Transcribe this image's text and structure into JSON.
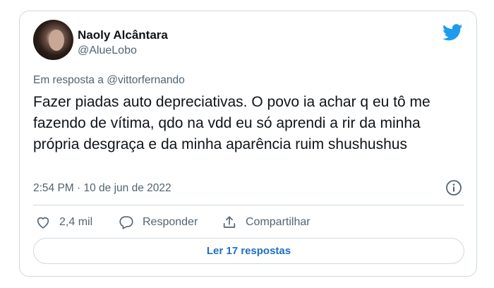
{
  "author": {
    "name": "Naoly Alcântara",
    "handle": "@AlueLobo"
  },
  "reply_to": {
    "prefix": "Em resposta a ",
    "handle": "@vittorfernando"
  },
  "tweet": {
    "text": "Fazer piadas auto depreciativas. O povo ia achar q eu tô me fazendo de vítima, qdo na vdd eu só aprendi a rir da minha própria desgraça e da minha aparência ruim shushushus",
    "timestamp": "2:54 PM · 10 de jun de 2022"
  },
  "actions": {
    "like_count": "2,4 mil",
    "reply_label": "Responder",
    "share_label": "Compartilhar"
  },
  "replies_button": "Ler 17 respostas",
  "icons": {
    "logo": "twitter-bird-icon",
    "info": "info-icon",
    "like": "heart-icon",
    "reply": "comment-icon",
    "share": "share-icon"
  },
  "colors": {
    "brand": "#1d9bf0",
    "text": "#0f1419",
    "muted": "#536471",
    "link_button": "#1d6fbf",
    "border": "#cfd9de"
  }
}
